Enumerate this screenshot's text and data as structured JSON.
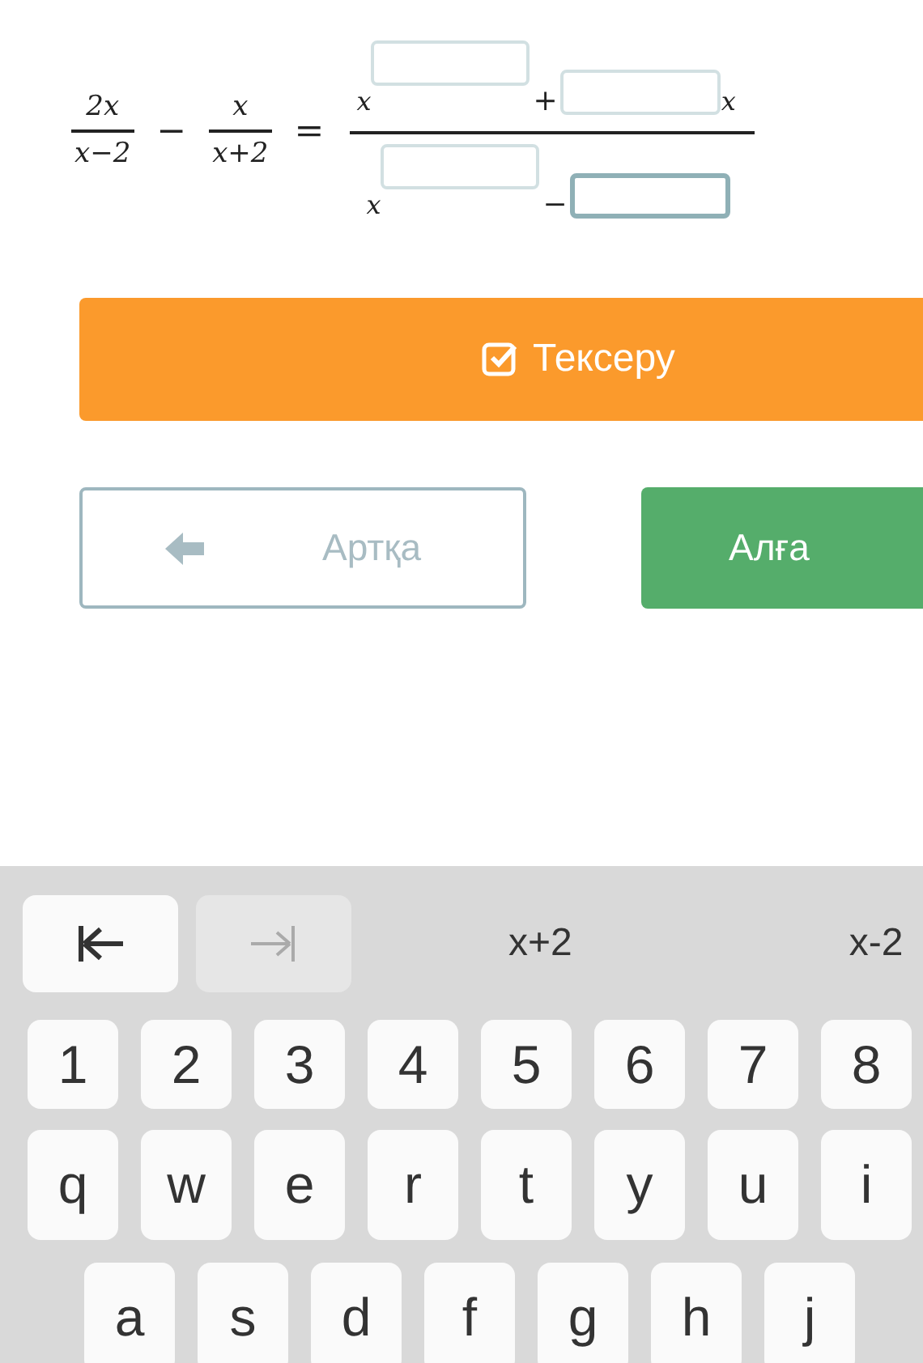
{
  "equation": {
    "lhs": [
      {
        "kind": "fraction",
        "numerator": "2x",
        "denominator": "x−2"
      },
      {
        "kind": "operator",
        "text": "−"
      },
      {
        "kind": "fraction",
        "numerator": "x",
        "denominator": "x+2"
      },
      {
        "kind": "operator",
        "text": "="
      }
    ],
    "rhs": {
      "numerator": [
        {
          "kind": "var",
          "text": "x"
        },
        {
          "kind": "sup_field",
          "focused": false
        },
        {
          "kind": "op",
          "text": "+"
        },
        {
          "kind": "field",
          "focused": false
        },
        {
          "kind": "var",
          "text": "x"
        }
      ],
      "denominator": [
        {
          "kind": "var",
          "text": "x"
        },
        {
          "kind": "sup_field",
          "focused": false
        },
        {
          "kind": "op",
          "text": "−"
        },
        {
          "kind": "field",
          "focused": true
        }
      ]
    }
  },
  "check_button": {
    "label": "Тексеру"
  },
  "nav": {
    "back": {
      "label": "Артқа"
    },
    "next": {
      "label": "Алға"
    }
  },
  "keyboard": {
    "toolbar": [
      {
        "kind": "prev",
        "disabled": false
      },
      {
        "kind": "next",
        "disabled": true
      },
      {
        "kind": "text",
        "label": "x+2"
      },
      {
        "kind": "text",
        "label": "x-2"
      }
    ],
    "rows": [
      [
        "1",
        "2",
        "3",
        "4",
        "5",
        "6",
        "7",
        "8"
      ],
      [
        "q",
        "w",
        "e",
        "r",
        "t",
        "y",
        "u",
        "i"
      ],
      [
        "a",
        "s",
        "d",
        "f",
        "g",
        "h",
        "j"
      ]
    ]
  }
}
